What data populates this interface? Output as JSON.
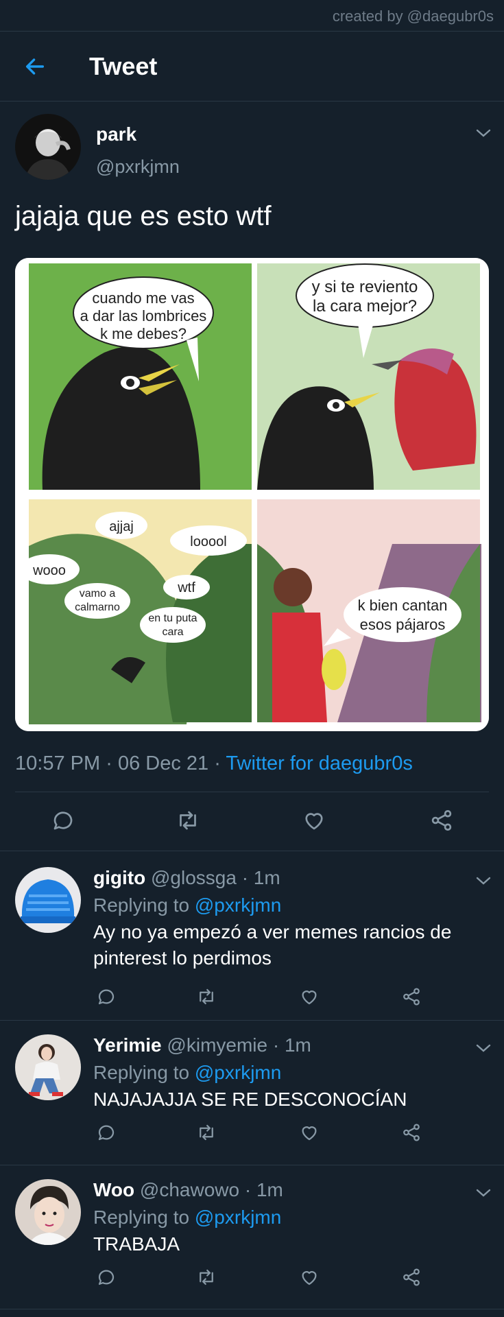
{
  "credit": "created by @daegubr0s",
  "header": {
    "title": "Tweet"
  },
  "tweet": {
    "name": "park",
    "handle": "@pxrkjmn",
    "text": "jajaja que es esto wtf",
    "time": "10:57 PM",
    "sep": "·",
    "date": "06 Dec 21",
    "source": "Twitter for daegubr0s"
  },
  "comic": {
    "panel1": [
      "cuando me vas",
      "a dar las lombrices",
      "k me debes?"
    ],
    "panel2": [
      "y si te reviento",
      "la cara mejor?"
    ],
    "panel3": {
      "ajjaj": "ajjaj",
      "looool": "looool",
      "wooo": "wooo",
      "vamo": [
        "vamo a",
        "calmarno"
      ],
      "wtf": "wtf",
      "tuputa": [
        "en tu puta",
        "cara"
      ]
    },
    "panel4": [
      "k bien cantan",
      "esos pájaros"
    ]
  },
  "replies": [
    {
      "name": "gigito",
      "handle": "@glossga",
      "time": "· 1m",
      "replying": "Replying to",
      "mention": "@pxrkjmn",
      "lines": [
        "Ay no ya empezó a ver memes rancios de",
        "pinterest lo perdimos"
      ]
    },
    {
      "name": "Yerimie",
      "handle": "@kimyemie",
      "time": "· 1m",
      "replying": "Replying to",
      "mention": "@pxrkjmn",
      "lines": [
        "NAJAJAJJA SE RE DESCONOCÍAN"
      ]
    },
    {
      "name": "Woo",
      "handle": "@chawowo",
      "time": "· 1m",
      "replying": "Replying to",
      "mention": "@pxrkjmn",
      "lines": [
        "TRABAJA"
      ]
    }
  ],
  "icons": {
    "back": "arrow-left-icon",
    "reply": "comment-icon",
    "retweet": "retweet-icon",
    "like": "heart-icon",
    "share": "share-icon",
    "more": "chevron-down-icon"
  },
  "colors": {
    "background": "#15202b",
    "accent": "#1d9bf0",
    "muted": "#8899a6",
    "divider": "#2a3845"
  }
}
